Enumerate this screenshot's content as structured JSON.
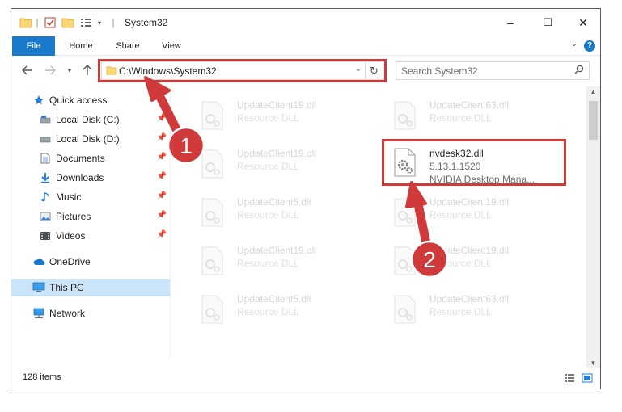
{
  "window": {
    "title": "System32",
    "controls": {
      "minimize": "–",
      "maximize": "☐",
      "close": "✕"
    }
  },
  "ribbon": {
    "tabs": [
      {
        "label": "File"
      },
      {
        "label": "Home"
      },
      {
        "label": "Share"
      },
      {
        "label": "View"
      }
    ],
    "help": "?"
  },
  "address": {
    "path": "C:\\Windows\\System32",
    "search_placeholder": "Search System32"
  },
  "sidebar": {
    "items": [
      {
        "label": "Quick access",
        "icon": "star-icon"
      },
      {
        "label": "Local Disk (C:)",
        "icon": "drive-icon",
        "pinned": true
      },
      {
        "label": "Local Disk (D:)",
        "icon": "drive-icon",
        "pinned": true
      },
      {
        "label": "Documents",
        "icon": "documents-icon",
        "pinned": true
      },
      {
        "label": "Downloads",
        "icon": "download-icon",
        "pinned": true
      },
      {
        "label": "Music",
        "icon": "music-icon",
        "pinned": true
      },
      {
        "label": "Pictures",
        "icon": "pictures-icon",
        "pinned": true
      },
      {
        "label": "Videos",
        "icon": "videos-icon",
        "pinned": true
      },
      {
        "label": "OneDrive",
        "icon": "cloud-icon"
      },
      {
        "label": "This PC",
        "icon": "computer-icon",
        "selected": true
      },
      {
        "label": "Network",
        "icon": "network-icon"
      }
    ]
  },
  "files": [
    {
      "name": "UpdateClient19.dll",
      "desc": "Resource DLL"
    },
    {
      "name": "UpdateClient63.dll",
      "desc": "Resource DLL"
    },
    {
      "name": "UpdateClient19.dll",
      "desc": "Resource DLL"
    },
    {
      "name": "nvdesk32.dll",
      "version": "5.13.1.1520",
      "desc": "NVIDIA Desktop Mana...",
      "highlighted": true
    },
    {
      "name": "UpdateClient5.dll",
      "desc": "Resource DLL"
    },
    {
      "name": "UpdateClient19.dll",
      "desc": "Resource DLL"
    },
    {
      "name": "UpdateClient19.dll",
      "desc": "Resource DLL"
    },
    {
      "name": "UpdateClient19.dll",
      "desc": "Resource DLL"
    },
    {
      "name": "UpdateClient5.dll",
      "desc": "Resource DLL"
    },
    {
      "name": "UpdateClient63.dll",
      "desc": "Resource DLL"
    }
  ],
  "status": {
    "item_count": "128 items"
  },
  "annotations": [
    {
      "label": "1"
    },
    {
      "label": "2"
    }
  ],
  "colors": {
    "accent": "#1979ca",
    "annotation_red": "#d03a3a",
    "selection": "#cce4f7"
  }
}
